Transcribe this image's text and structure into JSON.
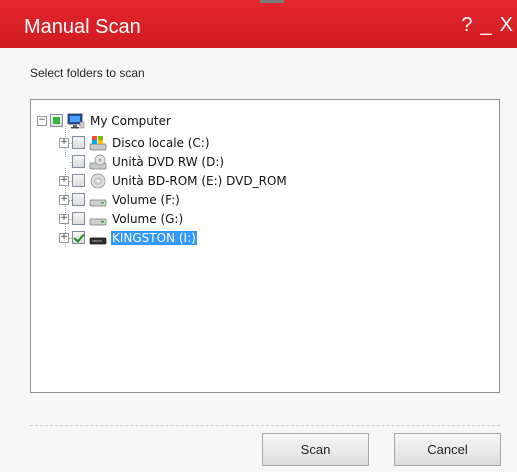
{
  "dialog": {
    "title": "Manual Scan",
    "help_label": "?",
    "minimize_label": "_",
    "close_label": "X",
    "instruction": "Select folders to scan"
  },
  "tree": {
    "root": {
      "label": "My Computer",
      "expander": "−",
      "check_state": "partial",
      "icon": "computer-icon"
    },
    "items": [
      {
        "label": "Disco locale (C:)",
        "expander": "+",
        "check_state": "unchecked",
        "icon": "windows-drive-icon"
      },
      {
        "label": "Unità DVD RW (D:)",
        "expander": "",
        "check_state": "unchecked",
        "icon": "dvd-drive-icon"
      },
      {
        "label": "Unità BD-ROM (E:) DVD_ROM",
        "expander": "+",
        "check_state": "unchecked",
        "icon": "disc-icon"
      },
      {
        "label": "Volume (F:)",
        "expander": "+",
        "check_state": "unchecked",
        "icon": "hard-drive-icon"
      },
      {
        "label": "Volume (G:)",
        "expander": "+",
        "check_state": "unchecked",
        "icon": "hard-drive-icon"
      },
      {
        "label": "KINGSTON (I:)",
        "expander": "+",
        "check_state": "checked",
        "icon": "usb-drive-icon",
        "selected": true
      }
    ]
  },
  "buttons": {
    "scan": "Scan",
    "cancel": "Cancel"
  },
  "colors": {
    "title_bar": "#d9222a",
    "selection": "#3399ff",
    "check_green": "#36b23f"
  }
}
